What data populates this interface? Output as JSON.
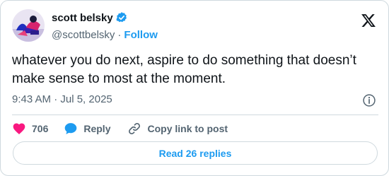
{
  "author": {
    "name": "scott belsky",
    "handle": "@scottbelsky",
    "separator": "·",
    "follow_label": "Follow",
    "verified_color": "#1d9bf0"
  },
  "tweet": {
    "text": "whatever you do next, aspire to do something that doesn’t make sense to most at the moment.",
    "timestamp": "9:43 AM · Jul 5, 2025"
  },
  "actions": {
    "like_count": "706",
    "reply_label": "Reply",
    "copy_link_label": "Copy link to post"
  },
  "footer": {
    "read_replies_label": "Read 26 replies"
  },
  "colors": {
    "accent": "#1d9bf0",
    "like": "#f91880",
    "text": "#0f1419",
    "muted": "#536471",
    "border": "#cfd9de"
  },
  "icons": [
    "avatar",
    "verified-badge-icon",
    "x-logo-icon",
    "info-icon",
    "heart-icon",
    "reply-bubble-icon",
    "link-icon"
  ]
}
